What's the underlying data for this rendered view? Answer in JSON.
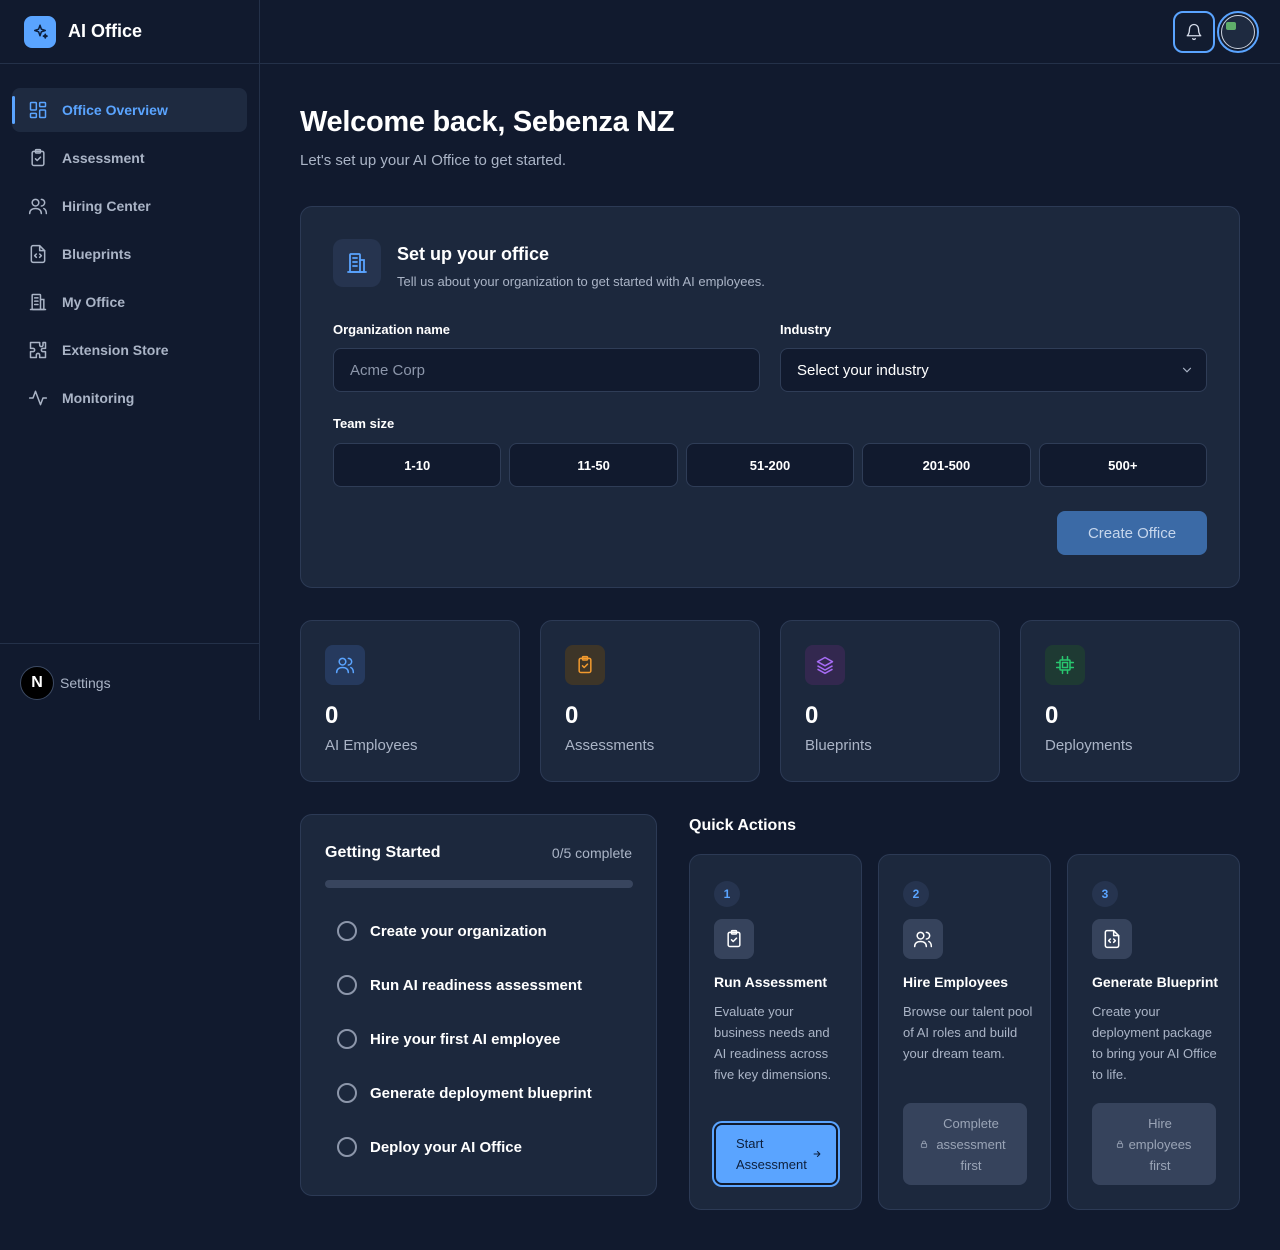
{
  "app": {
    "name": "AI Office"
  },
  "sidebar": {
    "items": [
      {
        "label": "Office Overview",
        "icon": "grid-icon",
        "active": true
      },
      {
        "label": "Assessment",
        "icon": "clipboard-check-icon"
      },
      {
        "label": "Hiring Center",
        "icon": "users-icon"
      },
      {
        "label": "Blueprints",
        "icon": "file-code-icon"
      },
      {
        "label": "My Office",
        "icon": "building-icon"
      },
      {
        "label": "Extension Store",
        "icon": "puzzle-icon"
      },
      {
        "label": "Monitoring",
        "icon": "activity-icon"
      }
    ],
    "settings": {
      "badge": "N",
      "label": "Settings"
    }
  },
  "header": {
    "welcome": "Welcome back, Sebenza NZ",
    "subtitle": "Let's set up your AI Office to get started."
  },
  "setup": {
    "title": "Set up your office",
    "description": "Tell us about your organization to get started with AI employees.",
    "org_label": "Organization name",
    "org_placeholder": "Acme Corp",
    "industry_label": "Industry",
    "industry_value": "Select your industry",
    "team_label": "Team size",
    "team_sizes": [
      "1-10",
      "11-50",
      "51-200",
      "201-500",
      "500+"
    ],
    "create_label": "Create Office"
  },
  "stats": [
    {
      "value": "0",
      "label": "AI Employees",
      "icon": "users-icon",
      "color": "#5aa4ff",
      "bg": "#263a5e"
    },
    {
      "value": "0",
      "label": "Assessments",
      "icon": "clipboard-check-icon",
      "color": "#f29a2e",
      "bg": "#3d3528"
    },
    {
      "value": "0",
      "label": "Blueprints",
      "icon": "layers-icon",
      "color": "#a66bf5",
      "bg": "#33284f"
    },
    {
      "value": "0",
      "label": "Deployments",
      "icon": "cpu-icon",
      "color": "#28c76f",
      "bg": "#1e3a33"
    }
  ],
  "getting_started": {
    "title": "Getting Started",
    "count": "0/5 complete",
    "progress": 0,
    "items": [
      "Create your organization",
      "Run AI readiness assessment",
      "Hire your first AI employee",
      "Generate deployment blueprint",
      "Deploy your AI Office"
    ]
  },
  "quick_actions": {
    "heading": "Quick Actions",
    "cards": [
      {
        "num": "1",
        "title": "Run Assessment",
        "desc": "Evaluate your business needs and AI readiness across five key dimensions.",
        "button": "Start Assessment",
        "icon": "clipboard-check-icon"
      },
      {
        "num": "2",
        "title": "Hire Employees",
        "desc": "Browse our talent pool of AI roles and build your dream team.",
        "button": "Complete assessment first",
        "icon": "users-icon"
      },
      {
        "num": "3",
        "title": "Generate Blueprint",
        "desc": "Create your deployment package to bring your AI Office to life.",
        "button": "Hire employees first",
        "icon": "file-code-icon"
      }
    ]
  }
}
